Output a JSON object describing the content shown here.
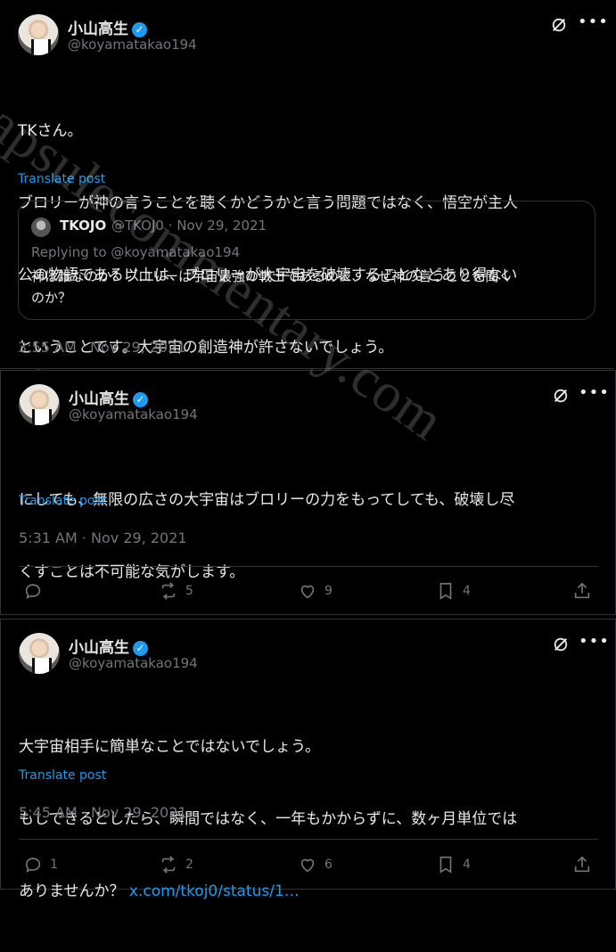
{
  "posts": [
    {
      "author_name": "小山高生",
      "handle": "@koyamatakao194",
      "text_lines": [
        "TKさん。",
        "ブロリーが神の言うことを聴くかどうかと言う問題ではなく、悟空が主人",
        "公の物語である以上は、ブロリーが大宇宙を破壊することなどあり得ない",
        "ということです。大宇宙の創造神が許さないでしょう。"
      ],
      "translate_label": "Translate post",
      "timestamp": "3:55 AM · Nov 29, 2021",
      "quote": {
        "author_name": "TKOJO",
        "meta": "@TKOJ0 · Nov 29, 2021",
        "replying_to": "Replying to @koyamatakao194",
        "text_lines": [
          "神は誰なのか？ブロリーは宇宙最強の戦士であるのに、なぜ神の言うことを聞く",
          "のか？"
        ]
      }
    },
    {
      "author_name": "小山高生",
      "handle": "@koyamatakao194",
      "text_lines": [
        "にしても、無限の広さの大宇宙はブロリーの力をもってしても、破壊し尽",
        "くすことは不可能な気がします。"
      ],
      "translate_label": "Translate post",
      "timestamp": "5:31 AM · Nov 29, 2021",
      "counts": {
        "replies": "",
        "reposts": "5",
        "likes": "9",
        "bookmarks": "4"
      }
    },
    {
      "author_name": "小山高生",
      "handle": "@koyamatakao194",
      "text_lines": [
        "大宇宙相手に簡単なことではないでしょう。",
        "もしできるとしたら、瞬間ではなく、一年もかからずに、数ヶ月単位では",
        "ありませんか？ "
      ],
      "link_text": "x.com/tkoj0/status/1…",
      "translate_label": "Translate post",
      "timestamp": "5:45 AM · Nov 29, 2021",
      "counts": {
        "replies": "1",
        "reposts": "2",
        "likes": "6",
        "bookmarks": "4"
      }
    }
  ],
  "watermark": "capsulecommentary.com",
  "colors": {
    "background": "#000000",
    "text": "#e7e9ea",
    "muted": "#71767b",
    "link": "#1d9bf0",
    "border": "#2f3336"
  },
  "icons": [
    "verified-badge-icon",
    "grok-icon",
    "more-icon",
    "reply-icon",
    "repost-icon",
    "like-icon",
    "bookmark-icon",
    "share-icon"
  ]
}
